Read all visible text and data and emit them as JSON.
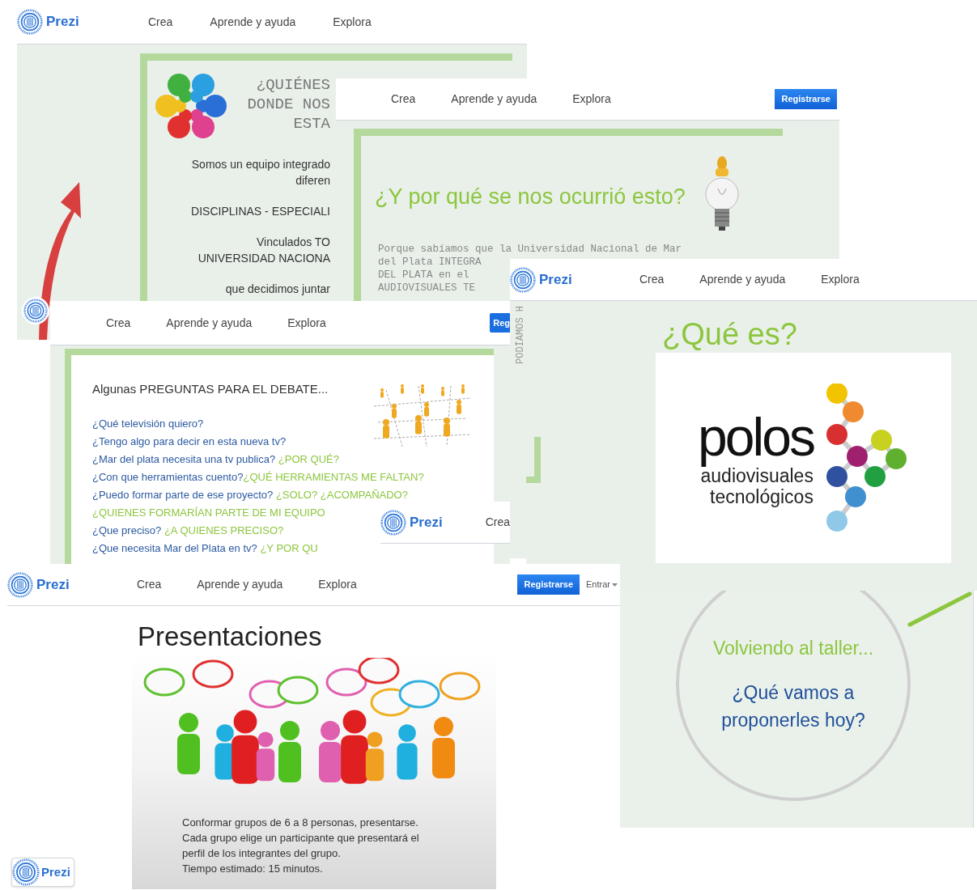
{
  "windows": [
    {
      "kind": "quienes",
      "header": {
        "brand": "Prezi",
        "links": [
          "Crea",
          "Aprende y ayuda",
          "Explora"
        ]
      },
      "title_lines": [
        "¿QUIÉNES",
        "DONDE NOS",
        "ESTA"
      ],
      "paragraphs": [
        [
          "Somos un equipo integrado",
          "diferen"
        ],
        [
          "DISCIPLINAS -  ESPECIALI"
        ],
        [
          "Vinculados TO",
          "UNIVERSIDAD NACIONA"
        ],
        [
          "que decidimos juntar"
        ]
      ]
    },
    {
      "kind": "porque",
      "header": {
        "links": [
          "Crea",
          "Aprende y ayuda",
          "Explora"
        ],
        "button": "Registrarse"
      },
      "title": "¿Y por qué se nos ocurrió esto?",
      "body_lines": [
        "Porque sabíamos que la Universidad Nacional de Mar",
        "del Plata INTEGRA",
        "DEL PLATA en el",
        "AUDIOVISUALES TE"
      ],
      "side_text": "PODÍAMOS H"
    },
    {
      "kind": "preguntas",
      "header": {
        "links": [
          "Crea",
          "Aprende y ayuda",
          "Explora"
        ],
        "button": "Reg"
      },
      "title": "Algunas PREGUNTAS PARA EL DEBATE...",
      "lines": [
        [
          {
            "text": "¿Qué televisión quiero?",
            "kind": "question"
          }
        ],
        [
          {
            "text": "¿Tengo algo para decir en esta nueva tv?",
            "kind": "question"
          }
        ],
        [
          {
            "text": "¿Mar del plata necesita una tv publica? ",
            "kind": "question"
          },
          {
            "text": "¿POR QUÉ?",
            "kind": "emphasis"
          }
        ],
        [
          {
            "text": "¿Con que herramientas cuento?",
            "kind": "question"
          },
          {
            "text": "¿QUÉ HERRAMIENTAS ME FALTAN?",
            "kind": "emphasis"
          }
        ],
        [
          {
            "text": "¿Puedo formar parte de ese proyecto? ",
            "kind": "question"
          },
          {
            "text": "¿SOLO? ¿ACOMPAÑADO?",
            "kind": "emphasis"
          }
        ],
        [
          {
            "text": "¿QUIENES FORMARÍAN PARTE DE MI EQUIPO",
            "kind": "emphasis"
          }
        ],
        [
          {
            "text": "¿Que preciso? ",
            "kind": "question"
          },
          {
            "text": "¿A QUIENES PRECISO?",
            "kind": "emphasis"
          }
        ],
        [
          {
            "text": "¿Que necesita Mar del Plata en tv? ",
            "kind": "question"
          },
          {
            "text": "¿Y POR QU",
            "kind": "emphasis"
          }
        ]
      ]
    },
    {
      "kind": "mini",
      "header": {
        "brand": "Prezi",
        "links": [
          "Crea"
        ]
      }
    },
    {
      "kind": "quees",
      "header": {
        "brand": "Prezi",
        "links": [
          "Crea",
          "Aprende y ayuda",
          "Explora"
        ]
      },
      "title": "¿Qué es?",
      "logo": {
        "word": "polos",
        "line_1": "audiovisuales",
        "line_2": "tecnológicos"
      }
    },
    {
      "kind": "presentaciones",
      "header": {
        "brand": "Prezi",
        "links": [
          "Crea",
          "Aprende y ayuda",
          "Explora"
        ],
        "button": "Registrarse",
        "login": "Entrar"
      },
      "title": "Presentaciones",
      "caption": [
        "Conformar grupos de 6 a 8 personas, presentarse.",
        "Cada grupo elige un participante que presentará el",
        "perfil de los integrantes del grupo.",
        "Tiempo estimado: 15 minutos."
      ],
      "badge": "Prezi"
    },
    {
      "kind": "taller",
      "title": "Volviendo al taller...",
      "question_lines": [
        "¿Qué vamos a",
        "proponerles hoy?"
      ]
    }
  ]
}
